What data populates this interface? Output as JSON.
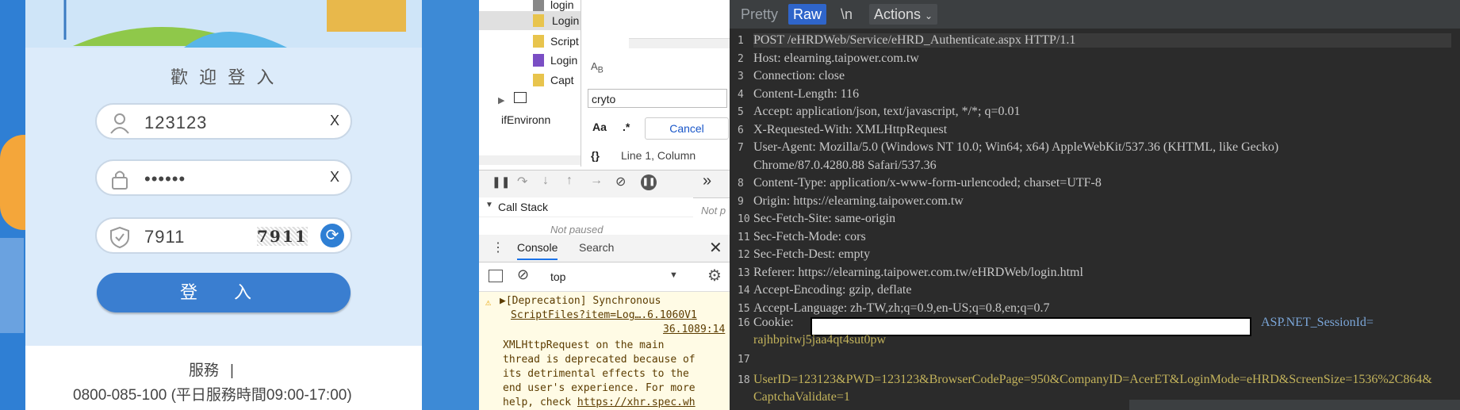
{
  "login": {
    "welcome": "歡 迎 登 入",
    "username_value": "123123",
    "password_value": "••••••",
    "captcha_value": "7911",
    "captcha_image_text": "7911",
    "clear_label": "X",
    "login_button": "登 入",
    "service_label": "服務",
    "service_phone": "0800-085-100 (平日服務時間09:00-17:00)"
  },
  "devtools": {
    "files": [
      "login",
      "Login",
      "Script",
      "Login",
      "Capt"
    ],
    "env_node": "ifEnvironn",
    "search_value": "cryto",
    "aa_label": "Aa",
    "regex_label": ".*",
    "cancel_label": "Cancel",
    "braces_label": "{}",
    "cursor_pos": "Line 1, Column",
    "call_stack_label": "Call Stack",
    "not_paused": "Not paused",
    "not_paused_short": "Not p",
    "console_tab": "Console",
    "search_tab": "Search",
    "context_value": "top",
    "msg_line1": "▶[Deprecation] Synchronous",
    "msg_link": "ScriptFiles?item=Log….6.1060V1",
    "msg_loc": "36.1089:14",
    "msg_body": [
      "XMLHttpRequest on the main",
      "thread is deprecated because of",
      "its detrimental effects to the",
      "end user's experience. For more",
      "help, check"
    ],
    "msg_url": "https://xhr.spec.wh"
  },
  "raw": {
    "tab_pretty": "Pretty",
    "tab_raw": "Raw",
    "tab_newline": "\\n",
    "tab_actions": "Actions",
    "lines": [
      {
        "n": "1",
        "t": "POST /eHRDWeb/Service/eHRD_Authenticate.aspx HTTP/1.1"
      },
      {
        "n": "2",
        "t": "Host: elearning.taipower.com.tw"
      },
      {
        "n": "3",
        "t": "Connection: close"
      },
      {
        "n": "4",
        "t": "Content-Length: 116"
      },
      {
        "n": "5",
        "t": "Accept: application/json, text/javascript, */*; q=0.01"
      },
      {
        "n": "6",
        "t": "X-Requested-With: XMLHttpRequest"
      },
      {
        "n": "7",
        "t": "User-Agent: Mozilla/5.0 (Windows NT 10.0; Win64; x64) AppleWebKit/537.36 (KHTML, like Gecko)"
      },
      {
        "n": "",
        "t": "Chrome/87.0.4280.88 Safari/537.36"
      },
      {
        "n": "8",
        "t": "Content-Type: application/x-www-form-urlencoded; charset=UTF-8"
      },
      {
        "n": "9",
        "t": "Origin: https://elearning.taipower.com.tw"
      },
      {
        "n": "10",
        "t": "Sec-Fetch-Site: same-origin"
      },
      {
        "n": "11",
        "t": "Sec-Fetch-Mode: cors"
      },
      {
        "n": "12",
        "t": "Sec-Fetch-Dest: empty"
      },
      {
        "n": "13",
        "t": "Referer: https://elearning.taipower.com.tw/eHRDWeb/login.html"
      },
      {
        "n": "14",
        "t": "Accept-Encoding: gzip, deflate"
      },
      {
        "n": "15",
        "t": "Accept-Language: zh-TW,zh;q=0.9,en-US;q=0.8,en;q=0.7"
      }
    ],
    "cookie_label": "Cookie:",
    "cookie_session": "ASP.NET_SessionId=",
    "cookie_value": "rajhbpitwj5jaa4qt4sut0pw",
    "body_line": "UserID=123123&PWD=123123&BrowserCodePage=950&CompanyID=AcerET&LoginMode=eHRD&ScreenSize=1536%2C864&",
    "body_line2": "CaptchaValidate=1"
  },
  "colors": {
    "accent_blue": "#3a7ed0",
    "raw_selected": "#2f65ca"
  }
}
